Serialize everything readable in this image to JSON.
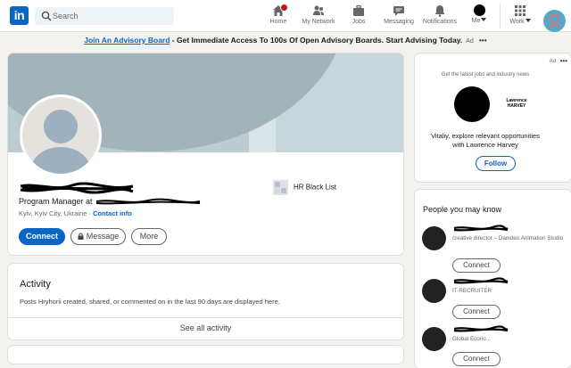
{
  "nav": {
    "logo": "in",
    "search_placeholder": "Search",
    "items": [
      {
        "label": "Home"
      },
      {
        "label": "My Network"
      },
      {
        "label": "Jobs"
      },
      {
        "label": "Messaging"
      },
      {
        "label": "Notifications"
      },
      {
        "label": "Me"
      },
      {
        "label": "Work"
      }
    ]
  },
  "ad_strip": {
    "link": "Join An Advisory Board",
    "text": " - Get Immediate Access To 100s Of Open Advisory Boards. Start Advising Today.",
    "tag": "Ad",
    "menu": "•••"
  },
  "profile": {
    "headline": "Program Manager at",
    "location": "Kyiv, Kyiv City, Ukraine",
    "contact_sep": " · ",
    "contact_info": "Contact info",
    "company": "HR Black List",
    "buttons": {
      "connect": "Connect",
      "message": "Message",
      "more": "More"
    }
  },
  "activity": {
    "title": "Activity",
    "description": "Posts Hryhorii created, shared, or commented on in the last 90 days are displayed here.",
    "see_all": "See all activity"
  },
  "right_ad": {
    "label": "Ad",
    "menu": "•••",
    "tagline": "Get the latest jobs and industry news",
    "brand_line1": "Lawrence",
    "brand_line2": "HARVEY",
    "pitch_line1": "Vitaliy, explore relevant opportunities",
    "pitch_line2": "with Lawrence Harvey",
    "follow": "Follow"
  },
  "pymk": {
    "title": "People you may know",
    "people": [
      {
        "role": "creative director – Danideo Animation Studio",
        "connect": "Connect"
      },
      {
        "role": "IT-RECRUITER",
        "connect": "Connect"
      },
      {
        "role": "Global Econo...",
        "connect": "Connect"
      }
    ]
  },
  "colors": {
    "brand": "#0a66c2",
    "page_bg": "#f3f2ef",
    "notification_badge": "#cc1016"
  }
}
